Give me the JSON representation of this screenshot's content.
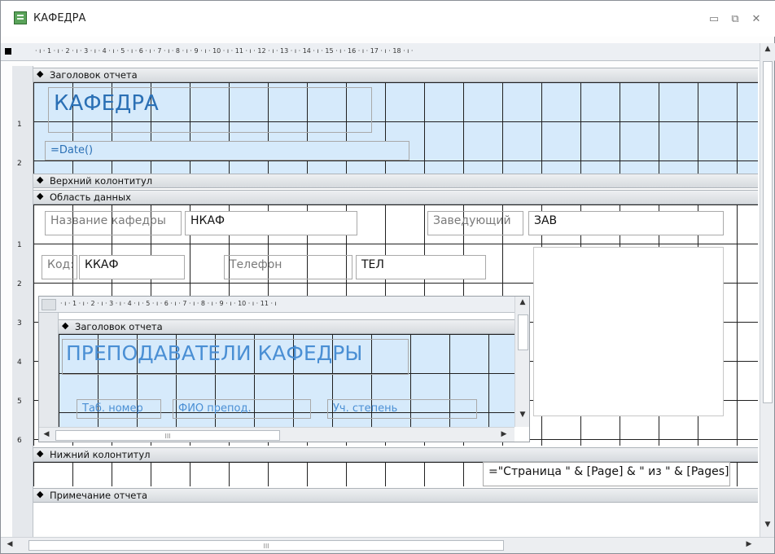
{
  "window": {
    "title": "КАФЕДРА",
    "minimize_glyph": "▭",
    "restore_glyph": "⧉",
    "close_glyph": "✕",
    "icon": "form-icon"
  },
  "ruler": {
    "top": "· ı · 1 · ı · 2 · ı · 3 · ı · 4 · ı · 5 · ı · 6 · ı · 7 · ı · 8 · ı · 9 · ı · 10 · ı · 11 · ı · 12 · ı · 13 · ı · 14 · ı · 15 · ı · 16 · ı · 17 · ı · 18 · ı ·",
    "sub": "· ı · 1 · ı · 2 · ı · 3 · ı · 4 · ı · 5 · ı · 6 · ı · 7 · ı · 8 · ı · 9 · ı · 10 · ı · 11 · ı"
  },
  "sections": {
    "report_header": "Заголовок отчета",
    "page_header": "Верхний колонтитул",
    "detail": "Область данных",
    "page_footer": "Нижний колонтитул",
    "report_footer": "Примечание отчета"
  },
  "report_header": {
    "title": "КАФЕДРА",
    "date_expr": "=Date()"
  },
  "detail": {
    "name_label": "Название кафедры",
    "name_field": "НКАФ",
    "head_label": "Заведующий",
    "head_field": "ЗАВ",
    "code_label": "Код:",
    "code_field": "ККАФ",
    "phone_label": "Телефон",
    "phone_field": "ТЕЛ"
  },
  "subreport": {
    "header_section": "Заголовок отчета",
    "title": "ПРЕПОДАВАТЕЛИ КАФЕДРЫ",
    "col_tab": "Таб. номер",
    "col_fio": "ФИО препод.",
    "col_degree": "Уч. степень",
    "scroll_text": "III"
  },
  "page_footer": {
    "page_expr": "=\"Страница \" & [Page] & \" из \" & [Pages]"
  },
  "hscroll_text": "III",
  "vruler": {
    "n1": "1",
    "n2": "2",
    "n3": "3",
    "n4": "4",
    "n5": "5",
    "n6": "6"
  }
}
